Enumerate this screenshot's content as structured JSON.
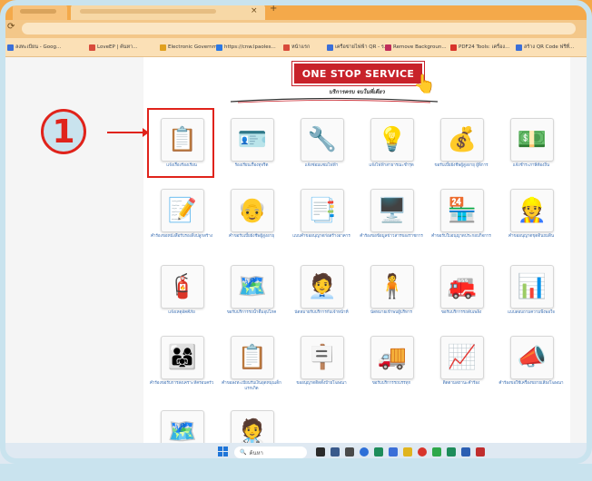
{
  "browser": {
    "tab_close": "×",
    "new_tab": "+",
    "bookmarks": [
      {
        "label": "ลงทะเบียน - Goog...",
        "color": "#3b6fd8"
      },
      {
        "label": "LoveEP | ค้นหา...",
        "color": "#d84b3b"
      },
      {
        "label": "Electronic Governm...",
        "color": "#e0a01e"
      },
      {
        "label": "https://cnw.lpaoles...",
        "color": "#2b78e4"
      },
      {
        "label": "หน้าแรก",
        "color": "#d84b3b"
      },
      {
        "label": "เครือข่ายไฟฟ้า QR - ร...",
        "color": "#3b6fd8"
      },
      {
        "label": "Remove Backgroun...",
        "color": "#c02d5a"
      },
      {
        "label": "PDF24 Tools: เครื่อง...",
        "color": "#d8342b"
      },
      {
        "label": "สร้าง QR Code ฟรีที่...",
        "color": "#3b6fd8"
      }
    ]
  },
  "header": {
    "banner": "ONE STOP SERVICE",
    "subtitle": "บริการครบ จบในที่เดียว"
  },
  "annotation": {
    "step_number": "1",
    "accent_color": "#e0231b"
  },
  "services": [
    {
      "icon": "📋",
      "label": "แจ้งเรื่องร้องเรียน"
    },
    {
      "icon": "🪪",
      "label": "ร้องเรียนเรื่องทุจริต"
    },
    {
      "icon": "🔧",
      "label": "แจ้งซ่อมแซมไฟฟ้า"
    },
    {
      "icon": "💡",
      "label": "แจ้งไฟฟ้าสาธารณะชำรุด"
    },
    {
      "icon": "💰",
      "label": "ขอรับเบี้ยยังชีพผู้สูงอายุ ผู้พิการ"
    },
    {
      "icon": "💵",
      "label": "แจ้งชำระภาษีท้องถิ่น"
    },
    {
      "icon": "📝",
      "label": "คำร้องขอหนังสือรับรองสิ่งปลูกสร้าง"
    },
    {
      "icon": "👴",
      "label": "คำขอรับเบี้ยยังชีพผู้สูงอายุ"
    },
    {
      "icon": "📑",
      "label": "แบบคำขออนุญาตก่อสร้างอาคาร"
    },
    {
      "icon": "🖥️",
      "label": "คำร้องขอข้อมูลข่าวสารของราชการ"
    },
    {
      "icon": "🏪",
      "label": "คำขอรับใบอนุญาตประกอบกิจการ"
    },
    {
      "icon": "👷",
      "label": "คำขออนุญาตขุดดินถมดิน"
    },
    {
      "icon": "🧯",
      "label": "แจ้งเหตุอัคคีภัย"
    },
    {
      "icon": "🗺️",
      "label": "ขอรับบริการรถน้ำดื่มอุปโภค"
    },
    {
      "icon": "🧑‍💼",
      "label": "นัดหมายรับบริการกับเจ้าหน้าที่"
    },
    {
      "icon": "🧍",
      "label": "นัดหมายเข้าพบผู้บริหาร"
    },
    {
      "icon": "🚒",
      "label": "ขอรับบริการรถดับเพลิง"
    },
    {
      "icon": "📊",
      "label": "แบบสอบถามความพึงพอใจ"
    },
    {
      "icon": "👨‍👩‍👧",
      "label": "คำร้องขอรับการสงเคราะห์ครอบครัว"
    },
    {
      "icon": "📋",
      "label": "คำขอลงทะเบียนรับเงินอุดหนุนเด็กแรกเกิด"
    },
    {
      "icon": "🪧",
      "label": "ขออนุญาตติดตั้งป้ายโฆษณา"
    },
    {
      "icon": "🚚",
      "label": "ขอรับบริการรถบรรทุก"
    },
    {
      "icon": "📈",
      "label": "ติดตามสถานะคำร้อง"
    },
    {
      "icon": "📣",
      "label": "คำร้องขอใช้เครื่องขยายเสียงโฆษณา"
    },
    {
      "icon": "🗺️",
      "label": ""
    },
    {
      "icon": "🧑‍⚕️",
      "label": ""
    }
  ],
  "taskbar": {
    "search_placeholder": "ค้นหา",
    "search_icon": "🔍"
  }
}
